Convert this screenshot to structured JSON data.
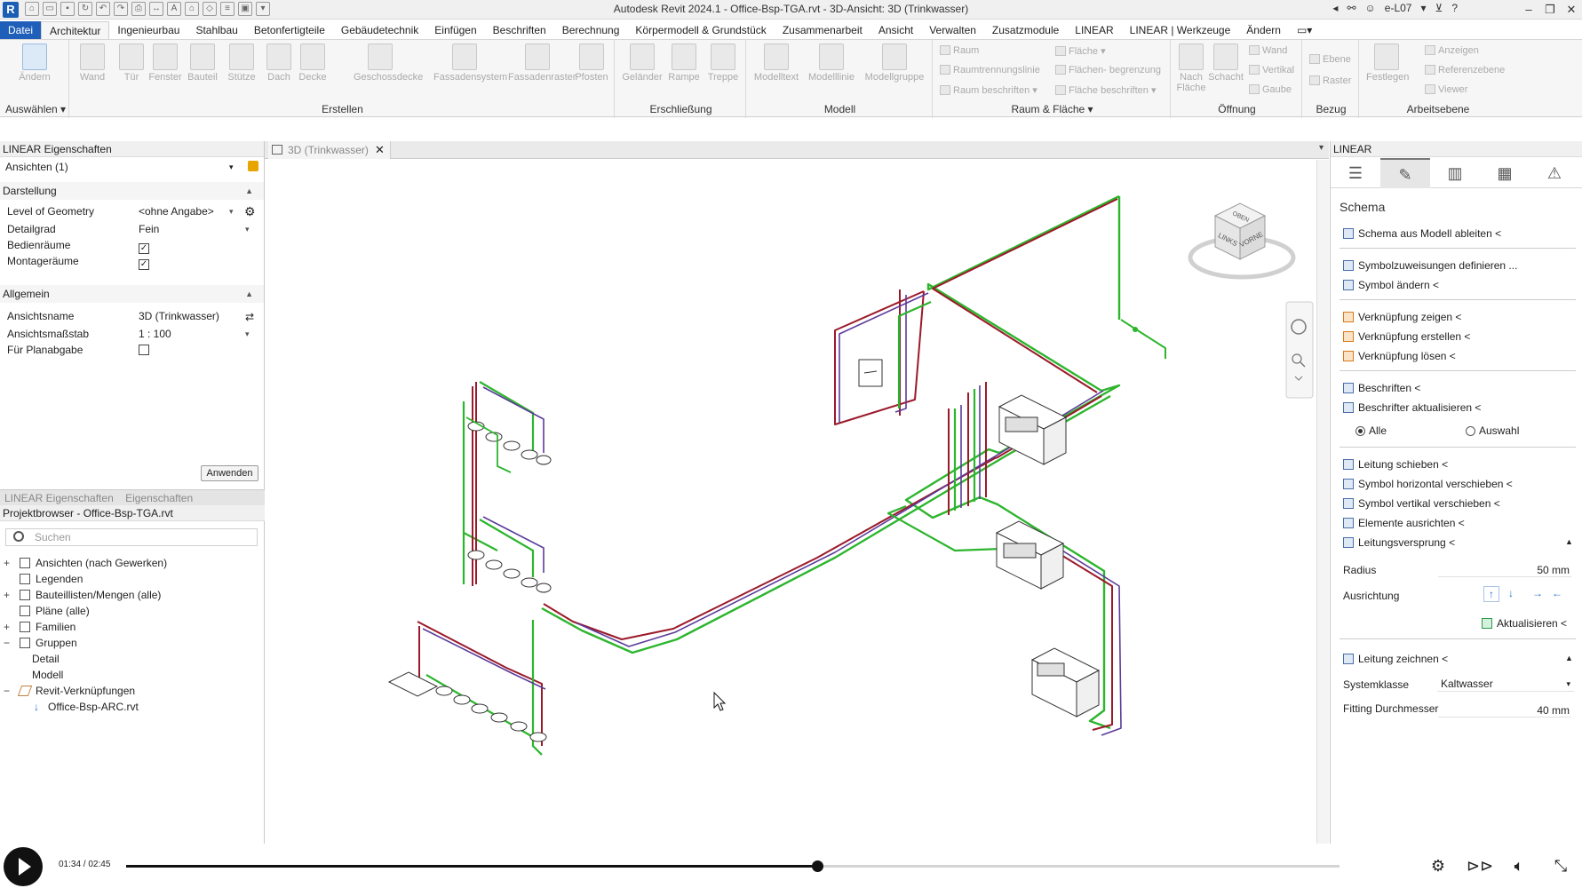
{
  "app": {
    "title": "Autodesk Revit 2024.1 - Office-Bsp-TGA.rvt - 3D-Ansicht: 3D (Trinkwasser)",
    "logo": "R",
    "user": "e-L07"
  },
  "ribbon": {
    "tabs": [
      "Datei",
      "Architektur",
      "Ingenieurbau",
      "Stahlbau",
      "Betonfertigteile",
      "Gebäudetechnik",
      "Einfügen",
      "Beschriften",
      "Berechnung",
      "Körpermodell & Grundstück",
      "Zusammenarbeit",
      "Ansicht",
      "Verwalten",
      "Zusatzmodule",
      "LINEAR",
      "LINEAR | Werkzeuge",
      "Ändern"
    ],
    "active_tab": "Architektur",
    "select_label": "Auswählen",
    "groups": {
      "select": {
        "button": "Ändern"
      },
      "create": {
        "label": "Erstellen",
        "buttons": [
          "Wand",
          "Tür",
          "Fenster",
          "Bauteil",
          "Stütze",
          "Dach",
          "Decke",
          "Geschossdecke",
          "Fassadensystem",
          "Fassadenraster",
          "Pfosten"
        ]
      },
      "access": {
        "label": "Erschließung",
        "buttons": [
          "Geländer",
          "Rampe",
          "Treppe"
        ]
      },
      "model": {
        "label": "Modell",
        "buttons": [
          "Modelltext",
          "Modelllinie",
          "Modellgruppe"
        ]
      },
      "room": {
        "label": "Raum & Fläche",
        "items": [
          "Raum",
          "Raumtrennungslinie",
          "Raum beschriften",
          "Fläche",
          "Flächen- begrenzung",
          "Fläche beschriften"
        ]
      },
      "opening": {
        "label": "Öffnung",
        "items": [
          "Nach Fläche",
          "Schacht",
          "Wand",
          "Vertikal",
          "Gaube"
        ]
      },
      "datum": {
        "label": "Bezug",
        "items": [
          "Ebene",
          "Raster"
        ]
      },
      "workplane": {
        "label": "Arbeitsebene",
        "items": [
          "Festlegen",
          "Anzeigen",
          "Referenzebene",
          "Viewer"
        ]
      }
    }
  },
  "properties": {
    "title": "LINEAR Eigenschaften",
    "type_selector": "Ansichten (1)",
    "sections": {
      "display": {
        "label": "Darstellung",
        "rows": [
          {
            "key": "Level of Geometry",
            "value": "<ohne Angabe>"
          },
          {
            "key": "Detailgrad",
            "value": "Fein"
          },
          {
            "key": "Bedienräume",
            "value": "checked"
          },
          {
            "key": "Montageräume",
            "value": "checked"
          }
        ]
      },
      "general": {
        "label": "Allgemein",
        "rows": [
          {
            "key": "Ansichtsname",
            "value": "3D (Trinkwasser)"
          },
          {
            "key": "Ansichtsmaßstab",
            "value": "1 : 100"
          },
          {
            "key": "Für Planabgabe",
            "value": "unchecked"
          }
        ]
      }
    },
    "apply_label": "Anwenden",
    "bottom_tabs": [
      "LINEAR Eigenschaften",
      "Eigenschaften"
    ]
  },
  "project_browser": {
    "title": "Projektbrowser - Office-Bsp-TGA.rvt",
    "search_placeholder": "Suchen",
    "items": [
      {
        "label": "Ansichten (nach Gewerken)",
        "level": 0,
        "expander": "+"
      },
      {
        "label": "Legenden",
        "level": 0,
        "expander": ""
      },
      {
        "label": "Bauteillisten/Mengen (alle)",
        "level": 0,
        "expander": "+"
      },
      {
        "label": "Pläne (alle)",
        "level": 0,
        "expander": ""
      },
      {
        "label": "Familien",
        "level": 0,
        "expander": "+"
      },
      {
        "label": "Gruppen",
        "level": 0,
        "expander": "−"
      },
      {
        "label": "Detail",
        "level": 1,
        "expander": ""
      },
      {
        "label": "Modell",
        "level": 1,
        "expander": ""
      },
      {
        "label": "Revit-Verknüpfungen",
        "level": 0,
        "expander": "−"
      },
      {
        "label": "Office-Bsp-ARC.rvt",
        "level": 1,
        "expander": ""
      }
    ]
  },
  "view": {
    "tab_label": "3D (Trinkwasser)",
    "viewcube": {
      "top": "OBEN",
      "left": "LINKS",
      "front": "VORNE"
    }
  },
  "linear_panel": {
    "title": "LINEAR",
    "section": "Schema",
    "commands": {
      "derive": "Schema aus Modell ableiten <",
      "define_symbols": "Symbolzuweisungen definieren ...",
      "change_symbol": "Symbol ändern <",
      "show_link": "Verknüpfung zeigen <",
      "create_link": "Verknüpfung erstellen <",
      "remove_link": "Verknüpfung lösen <",
      "annotate": "Beschriften <",
      "update_annotations": "Beschrifter aktualisieren <",
      "move_line": "Leitung schieben <",
      "move_h": "Symbol horizontal verschieben <",
      "move_v": "Symbol vertikal verschieben <",
      "align": "Elemente ausrichten <",
      "jump": "Leitungsversprung <",
      "update": "Aktualisieren <",
      "draw_line": "Leitung zeichnen <"
    },
    "radio": {
      "all": "Alle",
      "selection": "Auswahl"
    },
    "fields": {
      "radius_label": "Radius",
      "radius_value": "50 mm",
      "orientation_label": "Ausrichtung",
      "system_label": "Systemklasse",
      "system_value": "Kaltwasser",
      "fitting_label": "Fitting Durchmesser",
      "fitting_value": "40 mm"
    }
  },
  "player": {
    "time": "01:34 / 02:45",
    "progress": 0.5697
  },
  "colors": {
    "accent": "#1f5fb9",
    "pipe_green": "#2db52d",
    "pipe_red": "#9b1a2a",
    "pipe_purple": "#5b3b9a"
  }
}
